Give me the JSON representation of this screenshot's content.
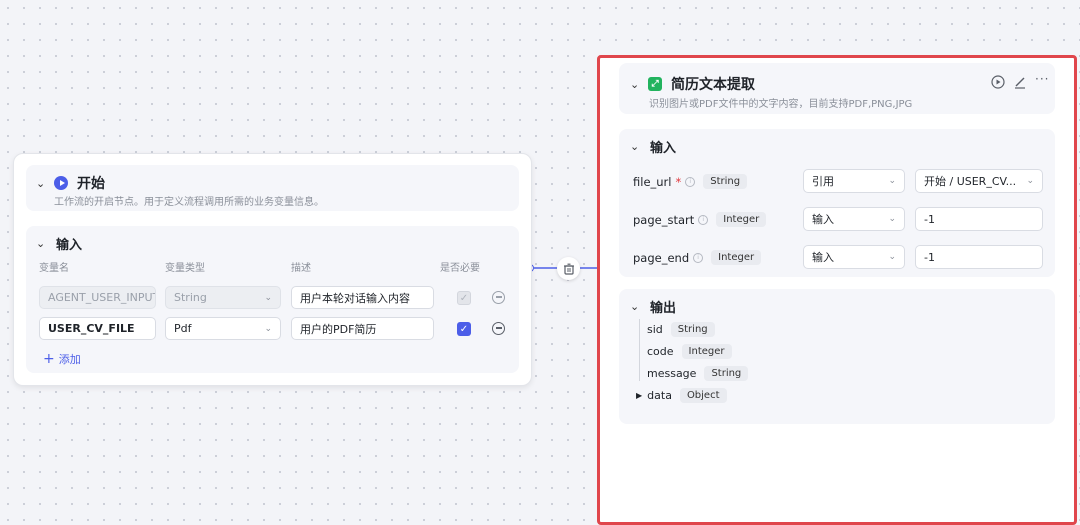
{
  "start_node": {
    "title": "开始",
    "subtitle": "工作流的开启节点。用于定义流程调用所需的业务变量信息。",
    "input_section_title": "输入",
    "columns": [
      "变量名",
      "变量类型",
      "描述",
      "是否必要"
    ],
    "rows": [
      {
        "name": "AGENT_USER_INPUT",
        "type": "String",
        "description": "用户本轮对话输入内容",
        "required": true,
        "disabled": true
      },
      {
        "name": "USER_CV_FILE",
        "type": "Pdf",
        "description": "用户的PDF简历",
        "required": true,
        "disabled": false
      }
    ],
    "add_label": "添加"
  },
  "extract_node": {
    "title": "简历文本提取",
    "subtitle": "识别图片或PDF文件中的文字内容，目前支持PDF,PNG,JPG",
    "input_section_title": "输入",
    "params": [
      {
        "name": "file_url",
        "required": true,
        "type": "String",
        "source": "引用",
        "value": "开始 / USER_CV..."
      },
      {
        "name": "page_start",
        "required": false,
        "type": "Integer",
        "source": "输入",
        "value": "-1"
      },
      {
        "name": "page_end",
        "required": false,
        "type": "Integer",
        "source": "输入",
        "value": "-1"
      }
    ],
    "output_section_title": "输出",
    "outputs": [
      {
        "name": "sid",
        "type": "String"
      },
      {
        "name": "code",
        "type": "Integer"
      },
      {
        "name": "message",
        "type": "String"
      },
      {
        "name": "data",
        "type": "Object"
      }
    ]
  },
  "colors": {
    "accent": "#4c5ee8",
    "highlight_border": "#e0464c",
    "node_icon_green": "#22b35e"
  }
}
